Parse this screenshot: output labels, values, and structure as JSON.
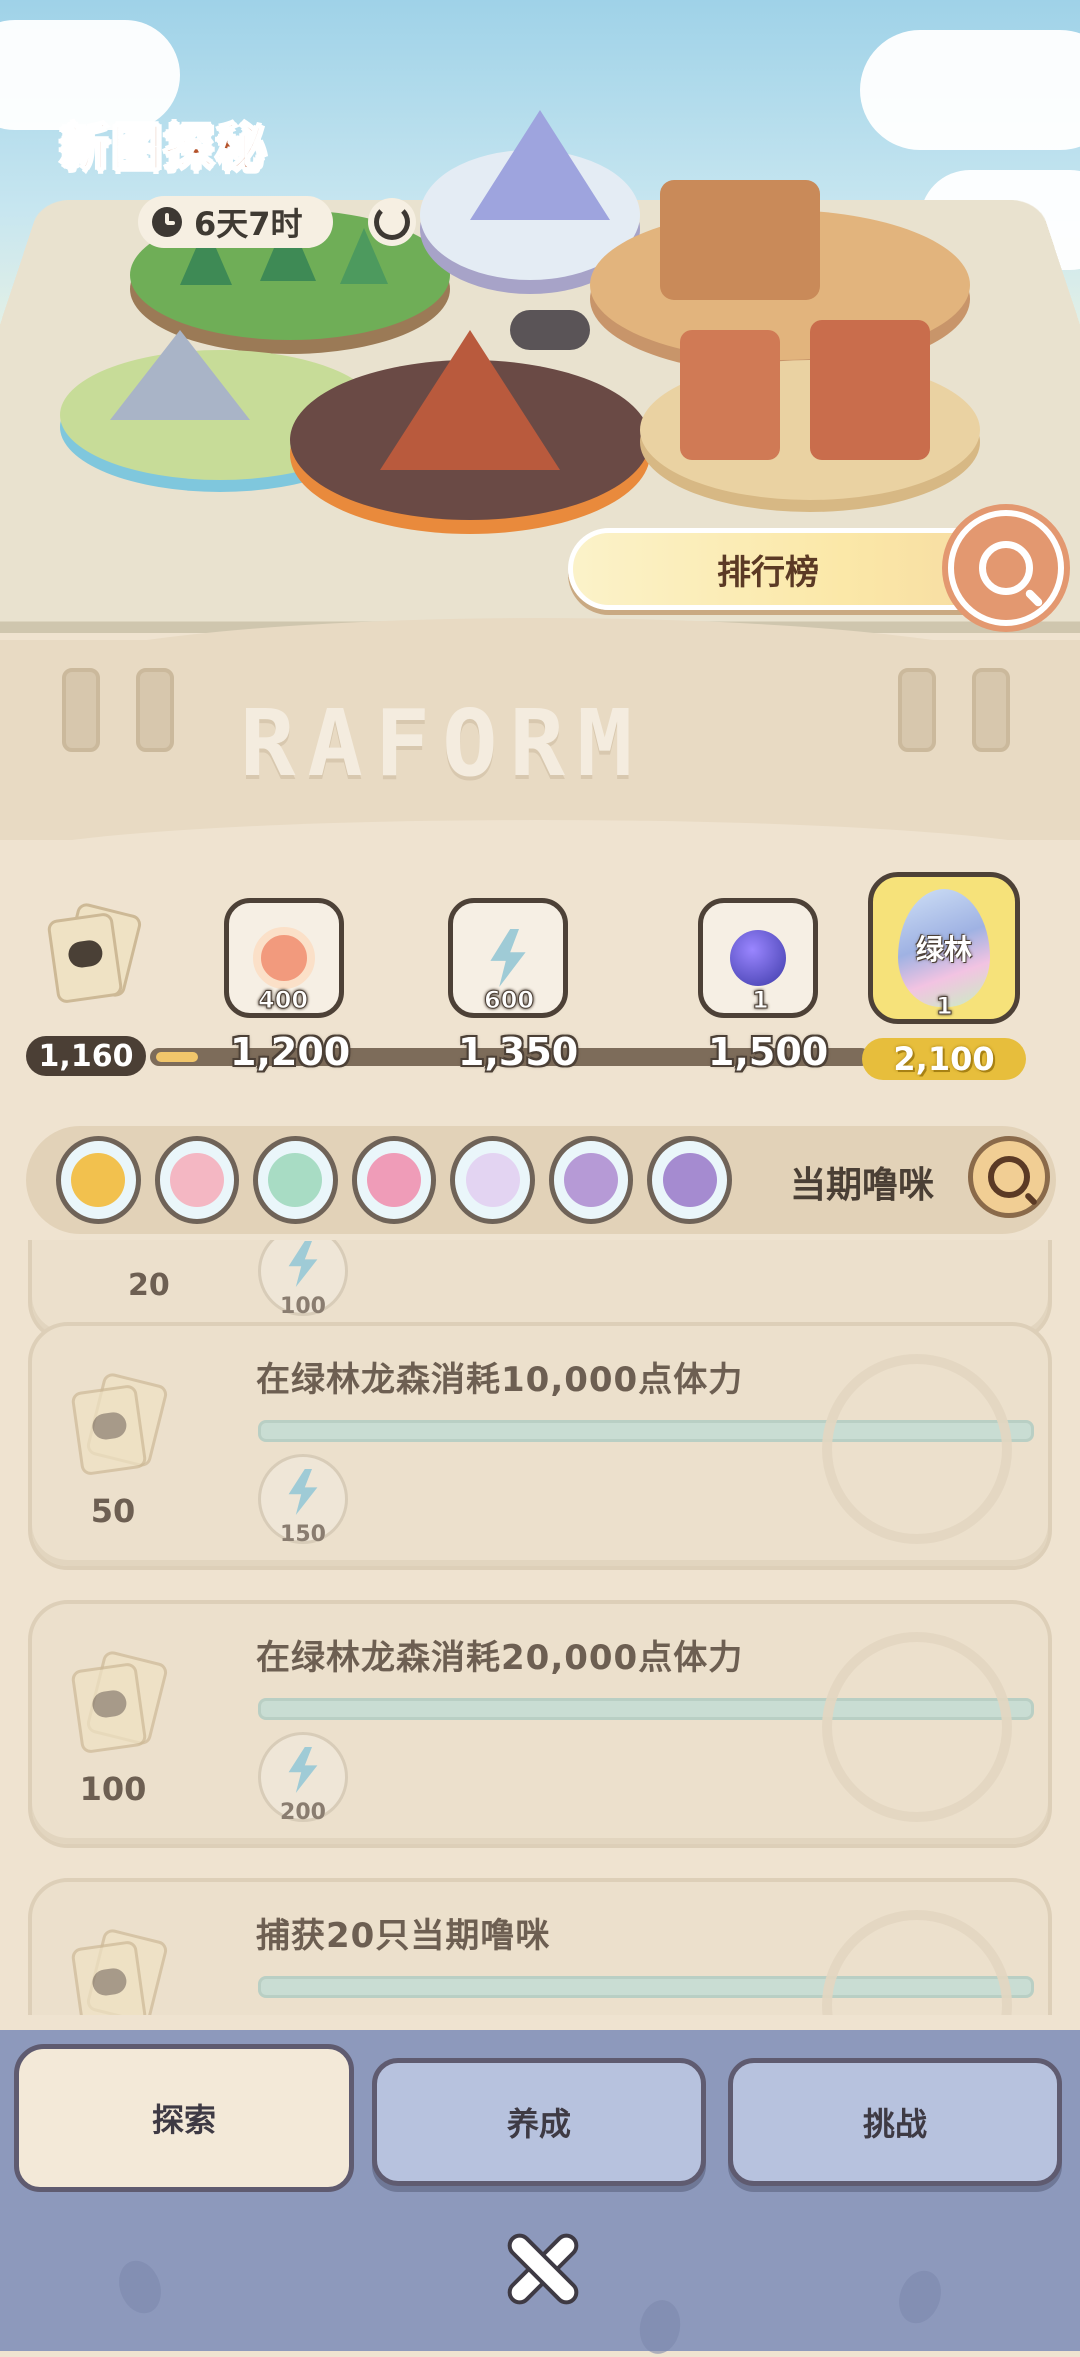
{
  "hero": {
    "title": "新图探秘",
    "timer": "6天7时",
    "rank_button": "排行榜"
  },
  "header_logo": "RAFORM",
  "progress": {
    "current_points": "1,160",
    "fill_fraction": 0.06,
    "milestones": [
      {
        "points": "1,200",
        "reward_qty": "400",
        "icon": "donut-icon"
      },
      {
        "points": "1,350",
        "reward_qty": "600",
        "icon": "energy-bolt-icon"
      },
      {
        "points": "1,500",
        "reward_qty": "1",
        "icon": "crystal-ball-icon"
      },
      {
        "points": "2,100",
        "reward_qty": "1",
        "icon": "green-forest-egg-icon",
        "egg_label": "绿林"
      }
    ]
  },
  "creatures": {
    "label": "当期噜咪",
    "items": [
      "yellow-hamster-creature",
      "pink-glasses-creature",
      "green-glasses-creature",
      "pink-flower-creature",
      "white-bird-creature",
      "purple-owl-creature",
      "purple-owl-creature-2"
    ]
  },
  "tasks": [
    {
      "title": "",
      "reward": "",
      "item_qty": "100"
    },
    {
      "title": "在绿林龙森消耗10,000点体力",
      "reward": "50",
      "item_qty": "150"
    },
    {
      "title": "在绿林龙森消耗20,000点体力",
      "reward": "100",
      "item_qty": "200"
    },
    {
      "title": "捕获20只当期噜咪",
      "reward": "",
      "item_qty": ""
    }
  ],
  "tabs": [
    {
      "label": "探索",
      "active": true
    },
    {
      "label": "养成",
      "active": false
    },
    {
      "label": "挑战",
      "active": false
    }
  ],
  "colors": {
    "accent_title": "#b5532b",
    "progress_fill": "#f1c66b",
    "final_badge": "#e7be3c",
    "tab_bar": "#8d99bc"
  }
}
